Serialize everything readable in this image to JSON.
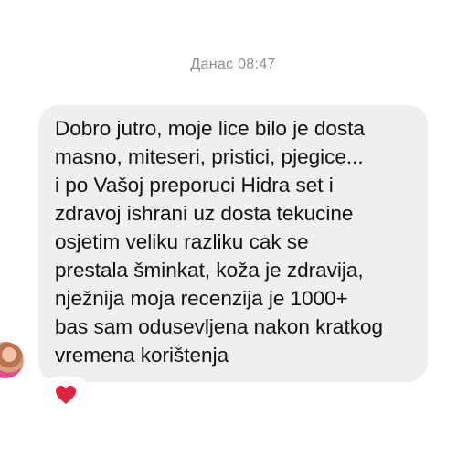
{
  "thread": {
    "timestamp": "Данас 08:47"
  },
  "message": {
    "text": "Dobro jutro, moje lice bilo je dosta\nmasno, miteseri, pristici, pjegice...\ni po Vašoj preporuci Hidra set i\nzdravoj ishrani uz dosta tekucine\nosjetim veliku razliku cak se\nprestala šminkat, koža je zdravija,\nnježnija moja recenzija je 1000+\nbas sam odusevljena nakon kratkog\nvremena korištenja"
  },
  "reaction": {
    "icon": "heart-icon",
    "color": "#e0243d"
  }
}
